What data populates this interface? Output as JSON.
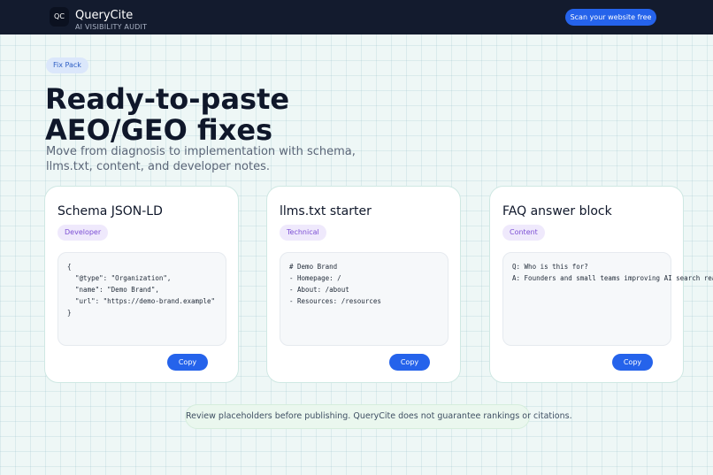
{
  "header": {
    "logo_text": "QC",
    "brand_name": "QueryCite",
    "brand_subtitle": "AI VISIBILITY AUDIT",
    "cta_label": "Scan your website free"
  },
  "hero": {
    "pill": "Fix Pack",
    "title": "Ready-to-paste AEO/GEO fixes",
    "subtitle": "Move from diagnosis to implementation with schema, llms.txt, content, and developer notes."
  },
  "cards": [
    {
      "title": "Schema JSON-LD",
      "tag": "Developer",
      "code": "{\n  \"@type\": \"Organization\",\n  \"name\": \"Demo Brand\",\n  \"url\": \"https://demo-brand.example\"\n}",
      "copy_label": "Copy"
    },
    {
      "title": "llms.txt starter",
      "tag": "Technical",
      "code": "# Demo Brand\n- Homepage: /\n- About: /about\n- Resources: /resources",
      "copy_label": "Copy"
    },
    {
      "title": "FAQ answer block",
      "tag": "Content",
      "code": "Q: Who is this for?\nA: Founders and small teams improving AI search readiness.",
      "copy_label": "Copy"
    }
  ],
  "notice": "Review placeholders before publishing. QueryCite does not guarantee rankings or citations.",
  "colors": {
    "header_bg": "#131b2e",
    "accent": "#2563eb",
    "tag_text": "#7c4fd4"
  }
}
